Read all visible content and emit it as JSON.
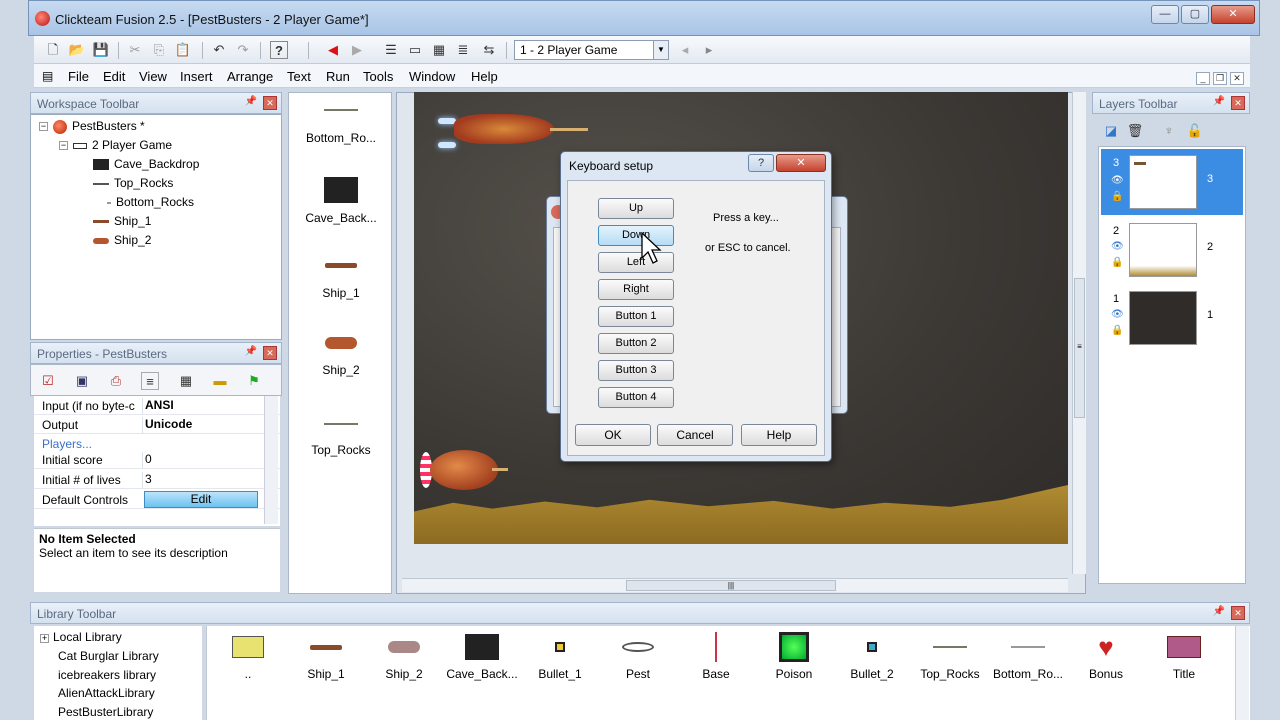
{
  "window": {
    "title": "Clickteam Fusion 2.5 - [PestBusters - 2 Player Game*]"
  },
  "toolbar": {
    "frame_select": "1 - 2 Player Game"
  },
  "menu": [
    "File",
    "Edit",
    "View",
    "Insert",
    "Arrange",
    "Text",
    "Run",
    "Tools",
    "Window",
    "Help"
  ],
  "workspace": {
    "header": "Workspace Toolbar",
    "root": "PestBusters *",
    "frame": "2 Player Game",
    "items": [
      "Cave_Backdrop",
      "Top_Rocks",
      "Bottom_Rocks",
      "Ship_1",
      "Ship_2"
    ]
  },
  "properties": {
    "header": "Properties - PestBusters",
    "rows": [
      {
        "key": "Input (if no byte-c",
        "value": "ANSI"
      },
      {
        "key": "Output",
        "value": "Unicode"
      },
      {
        "key": "Players...",
        "value": ""
      },
      {
        "key": "Initial score",
        "value": "0"
      },
      {
        "key": "Initial # of lives",
        "value": "3"
      },
      {
        "key": "Default Controls",
        "value": "Edit"
      }
    ],
    "desc_title": "No Item Selected",
    "desc_text": "Select an item to see its description"
  },
  "object_list": [
    "Bottom_Ro...",
    "Cave_Back...",
    "Ship_1",
    "Ship_2",
    "Top_Rocks"
  ],
  "dialog": {
    "title": "Keyboard setup",
    "help_btn": "?",
    "keys": [
      "Up",
      "Down",
      "Left",
      "Right",
      "Button 1",
      "Button 2",
      "Button 3",
      "Button 4"
    ],
    "prompt1": "Press a key...",
    "prompt2": "or ESC to cancel.",
    "ok": "OK",
    "cancel": "Cancel",
    "help": "Help"
  },
  "layers": {
    "header": "Layers Toolbar",
    "items": [
      {
        "num": "3",
        "right": "3"
      },
      {
        "num": "2",
        "right": "2"
      },
      {
        "num": "1",
        "right": "1"
      }
    ]
  },
  "library": {
    "header": "Library Toolbar",
    "tree": [
      "Local Library",
      "Cat Burglar Library",
      "icebreakers library",
      "AlienAttackLibrary",
      "PestBusterLibrary"
    ],
    "items": [
      "..",
      "Ship_1",
      "Ship_2",
      "Cave_Back...",
      "Bullet_1",
      "Pest",
      "Base",
      "Poison",
      "Bullet_2",
      "Top_Rocks",
      "Bottom_Ro...",
      "Bonus",
      "Title"
    ]
  }
}
